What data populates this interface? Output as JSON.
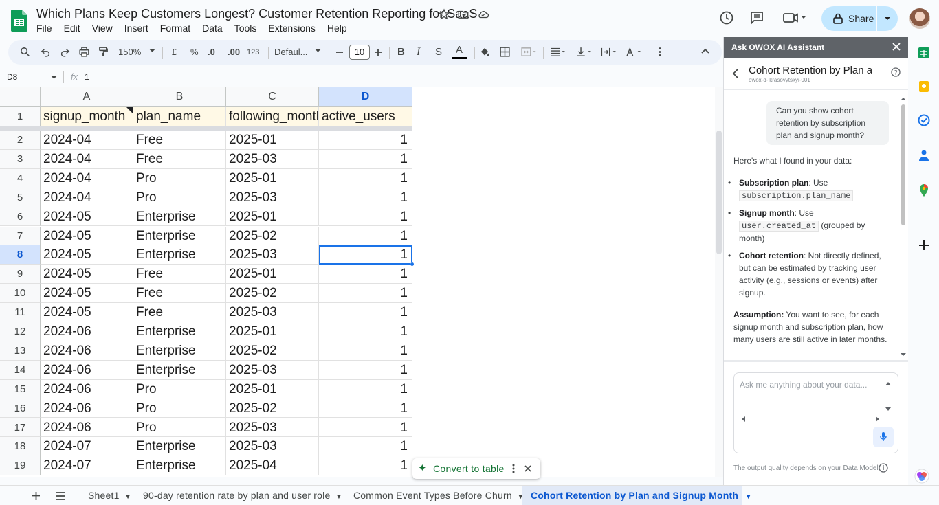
{
  "doc": {
    "title": "Which Plans Keep Customers Longest? Customer Retention Reporting for SaaS"
  },
  "menu": [
    "File",
    "Edit",
    "View",
    "Insert",
    "Format",
    "Data",
    "Tools",
    "Extensions",
    "Help"
  ],
  "share": {
    "label": "Share"
  },
  "toolbar": {
    "zoom": "150%",
    "currency": "£",
    "percent": "%",
    "dec_less": ".0",
    "dec_more": ".00",
    "number_format": "123",
    "font": "Defaul...",
    "font_size": "10"
  },
  "formula": {
    "name_box": "D8",
    "fx": "fx",
    "value": "1"
  },
  "sheet": {
    "columns": [
      "A",
      "B",
      "C",
      "D"
    ],
    "selected_col": "D",
    "selected_row": 8,
    "header": [
      "signup_month",
      "plan_name",
      "following_month",
      "active_users"
    ],
    "rows": [
      [
        "2024-04",
        "Free",
        "2025-01",
        "1"
      ],
      [
        "2024-04",
        "Free",
        "2025-03",
        "1"
      ],
      [
        "2024-04",
        "Pro",
        "2025-01",
        "1"
      ],
      [
        "2024-04",
        "Pro",
        "2025-03",
        "1"
      ],
      [
        "2024-05",
        "Enterprise",
        "2025-01",
        "1"
      ],
      [
        "2024-05",
        "Enterprise",
        "2025-02",
        "1"
      ],
      [
        "2024-05",
        "Enterprise",
        "2025-03",
        "1"
      ],
      [
        "2024-05",
        "Free",
        "2025-01",
        "1"
      ],
      [
        "2024-05",
        "Free",
        "2025-02",
        "1"
      ],
      [
        "2024-05",
        "Free",
        "2025-03",
        "1"
      ],
      [
        "2024-06",
        "Enterprise",
        "2025-01",
        "1"
      ],
      [
        "2024-06",
        "Enterprise",
        "2025-02",
        "1"
      ],
      [
        "2024-06",
        "Enterprise",
        "2025-03",
        "1"
      ],
      [
        "2024-06",
        "Pro",
        "2025-01",
        "1"
      ],
      [
        "2024-06",
        "Pro",
        "2025-02",
        "1"
      ],
      [
        "2024-06",
        "Pro",
        "2025-03",
        "1"
      ],
      [
        "2024-07",
        "Enterprise",
        "2025-03",
        "1"
      ],
      [
        "2024-07",
        "Enterprise",
        "2025-04",
        "1"
      ]
    ]
  },
  "convert": {
    "label": "Convert to table"
  },
  "panel": {
    "header": "Ask OWOX AI Assistant",
    "title": "Cohort Retention by Plan and Signup Month",
    "subtitle": "owox-d-ikrasovytskyi-001",
    "user_message": "Can you show cohort retention by subscription plan and signup month?",
    "intro": "Here's what I found in your data:",
    "b1_label": "Subscription plan",
    "b1_text": ": Use",
    "b1_code": "subscription.plan_name",
    "b2_label": "Signup month",
    "b2_text": ": Use",
    "b2_code": "user.created_at",
    "b2_tail": "(grouped by month)",
    "b3_label": "Cohort retention",
    "b3_text": ": Not directly defined, but can be estimated by tracking user activity (e.g., sessions or events) after signup.",
    "assume_label": "Assumption:",
    "assume_text": "You want to see, for each signup month and subscription plan, how many users are still active in later months.",
    "placeholder": "Ask me anything about your data...",
    "footnote": "The output quality depends on your Data Model"
  },
  "tabs": [
    "Sheet1",
    "90-day retention rate by plan and user role",
    "Common Event Types Before Churn",
    "Cohort Retention by Plan and Signup Month"
  ],
  "colors": {
    "accent": "#0b57d0",
    "selection": "#1a73e8",
    "sheets_green": "#0f9d58"
  }
}
